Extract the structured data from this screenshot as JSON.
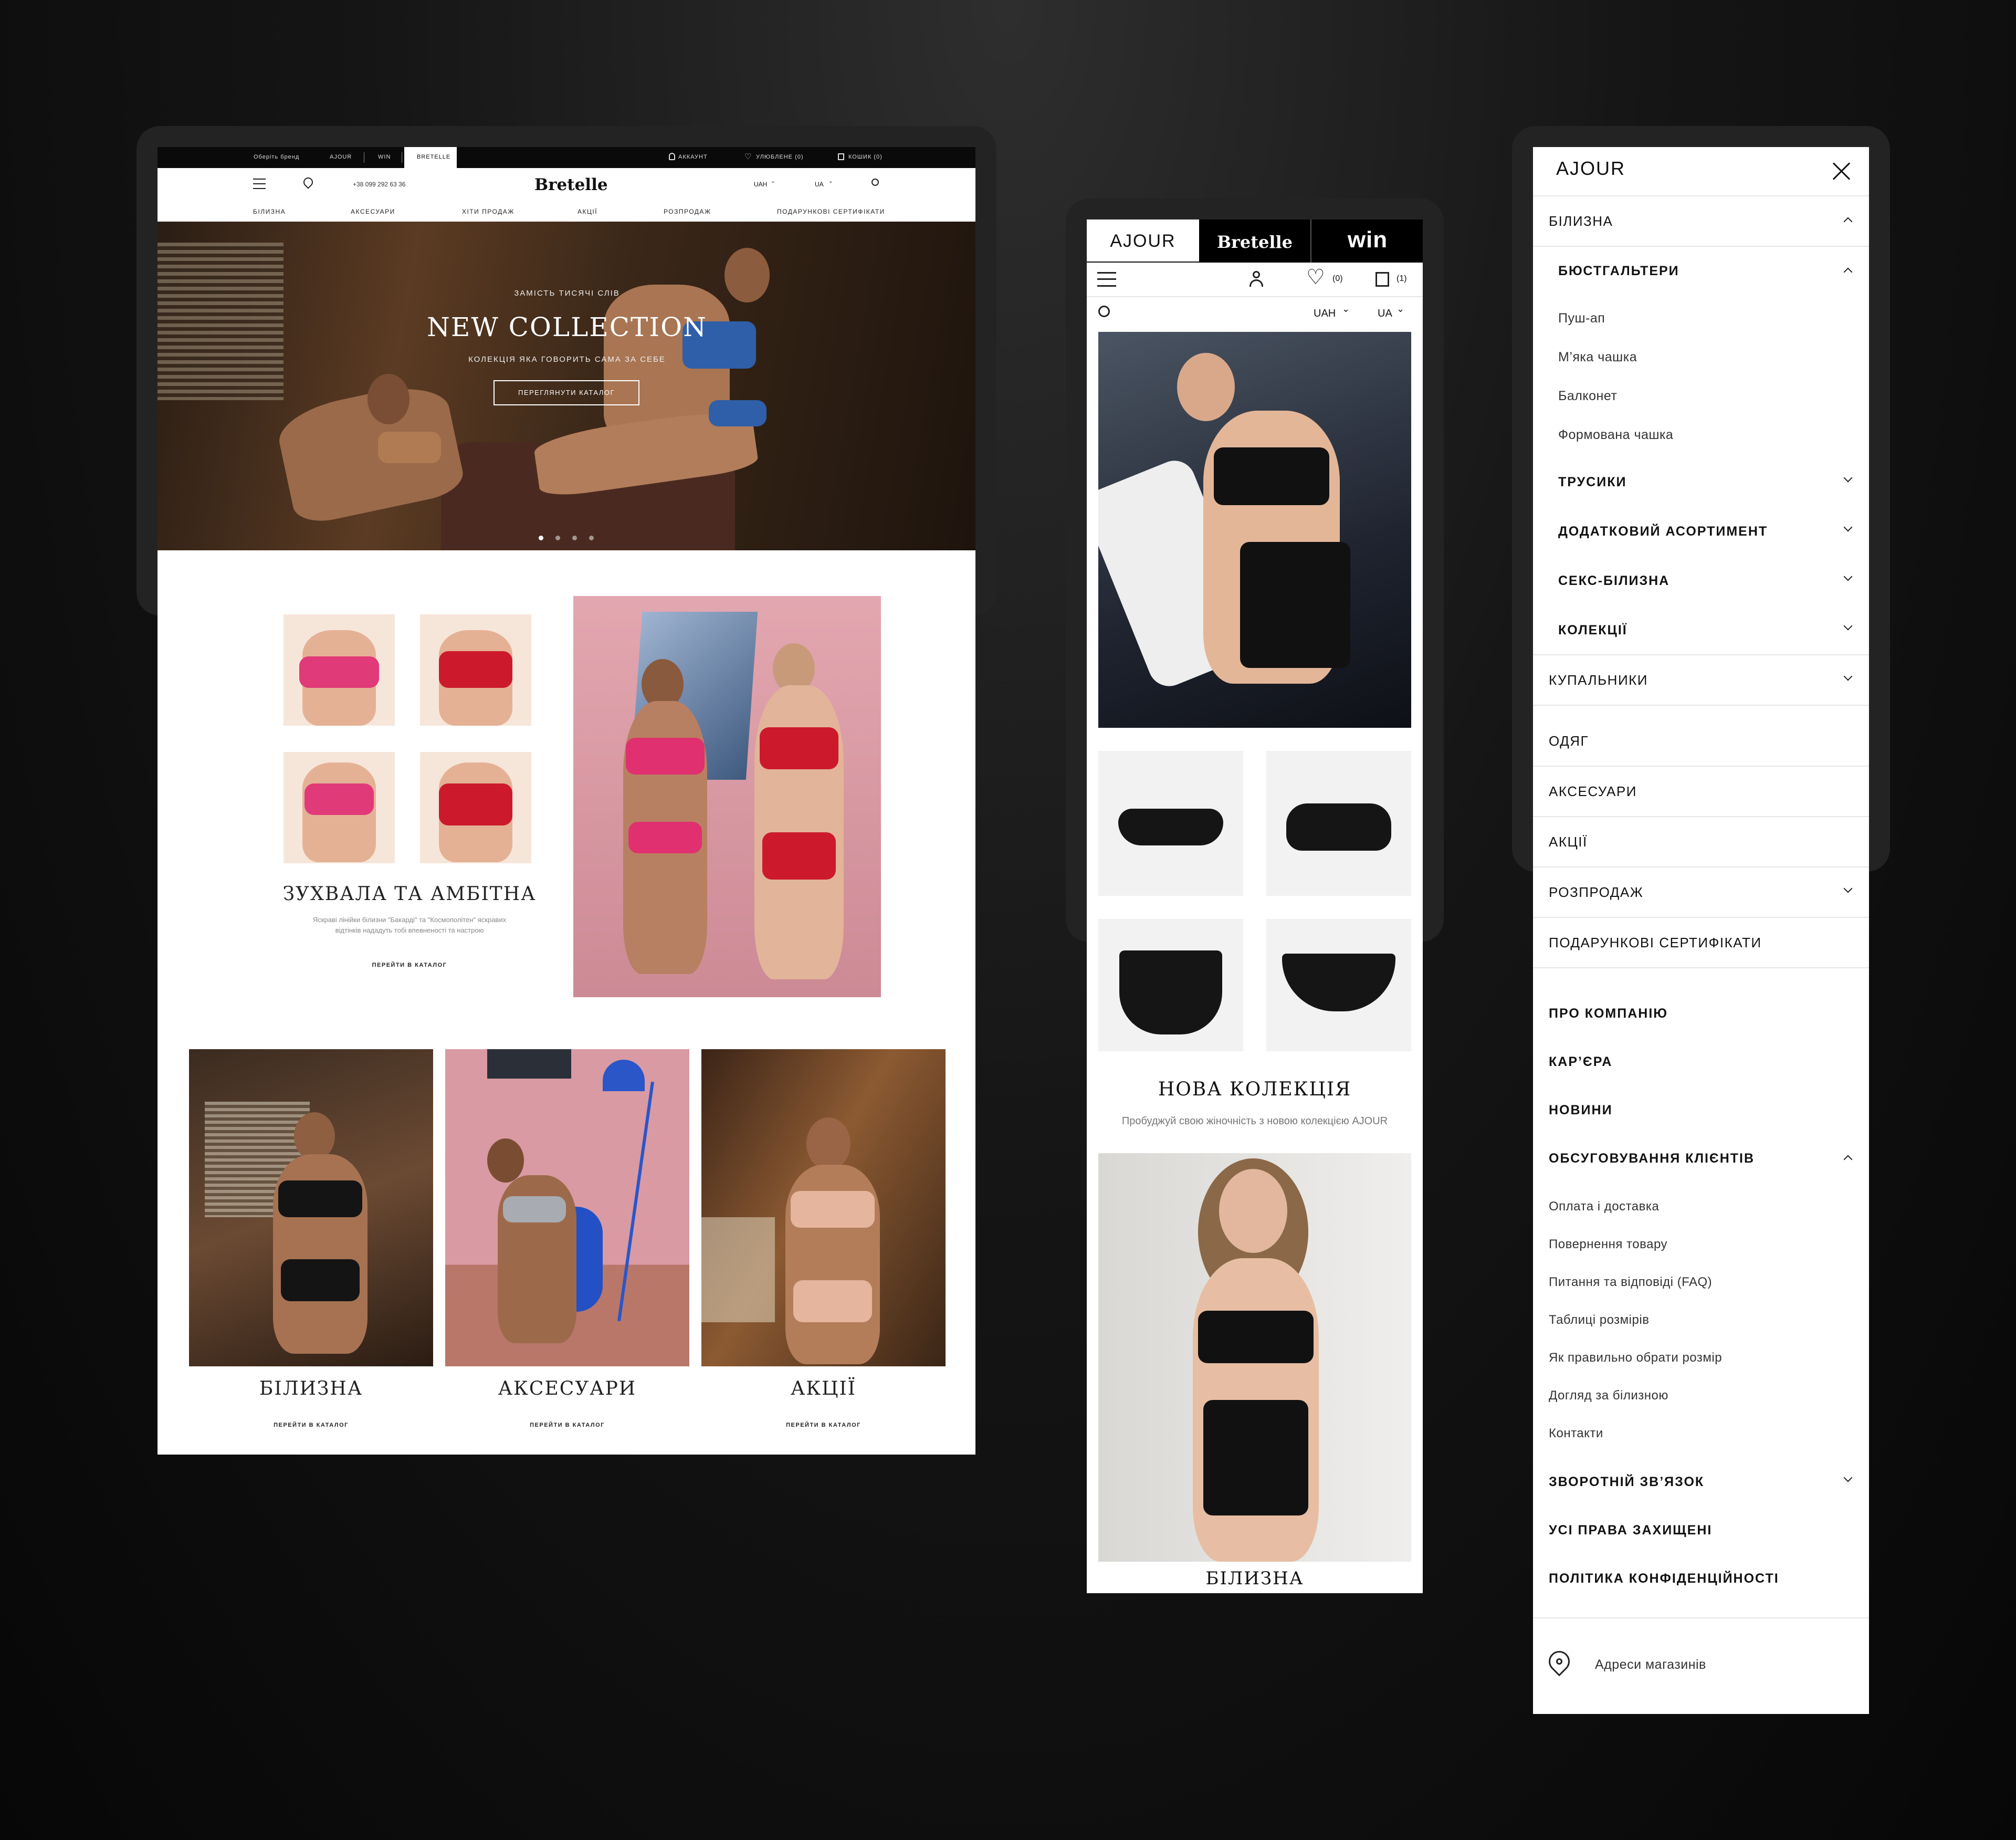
{
  "desktop": {
    "topbar": {
      "choose_brand": "Оберіть бренд",
      "brands": [
        "AJOUR",
        "WIN",
        "BRETELLE"
      ],
      "account": "АККАУНТ",
      "favorites": "УЛЮБЛЕНЕ (0)",
      "cart": "КОШИК (0)"
    },
    "header": {
      "logo": "Bretelle",
      "phone": "+38 099 292 63 36",
      "currency": "UAH",
      "language": "UA"
    },
    "nav": [
      "БІЛИЗНА",
      "АКСЕСУАРИ",
      "ХІТИ ПРОДАЖ",
      "АКЦІЇ",
      "РОЗПРОДАЖ",
      "ПОДАРУНКОВІ СЕРТИФІКАТИ"
    ],
    "hero": {
      "kicker": "ЗАМІСТЬ ТИСЯЧІ СЛІВ",
      "title": "NEW COLLECTION",
      "subtitle": "КОЛЕКЦІЯ ЯКА ГОВОРИТЬ САМА ЗА СЕБЕ",
      "cta": "ПЕРЕГЛЯНУТИ КАТАЛОГ",
      "slides": 4,
      "active_slide": 1
    },
    "promo": {
      "title": "ЗУХВАЛА ТА АМБІТНА",
      "text_line1": "Яскраві лінійки білизни \"Бакарді\" та \"Космополітен\" яскравих",
      "text_line2": "відтінків нададуть тобі впевненості та настрою",
      "link": "ПЕРЕЙТИ В КАТАЛОГ"
    },
    "categories": [
      {
        "title": "БІЛИЗНА",
        "link": "ПЕРЕЙТИ В КАТАЛОГ"
      },
      {
        "title": "АКСЕСУАРИ",
        "link": "ПЕРЕЙТИ В КАТАЛОГ"
      },
      {
        "title": "АКЦІЇ",
        "link": "ПЕРЕЙТИ В КАТАЛОГ"
      }
    ]
  },
  "mobile": {
    "brand_tabs": [
      "AJOUR",
      "Bretelle",
      "win"
    ],
    "favorites_count": "(0)",
    "cart_count": "(1)",
    "currency": "UAH",
    "language": "UA",
    "collection": {
      "title": "НОВА КОЛЕКЦІЯ",
      "text": "Пробуджуй свою жіночність з новою колекцією AJOUR"
    },
    "category": "БІЛИЗНА"
  },
  "menu": {
    "brand": "AJOUR",
    "lingerie": "БІЛИЗНА",
    "bras": "БЮСТГАЛЬТЕРИ",
    "bra_types": [
      "Пуш-ап",
      "М’яка чашка",
      "Балконет",
      "Формована чашка"
    ],
    "lingerie_sub": [
      "ТРУСИКИ",
      "ДОДАТКОВИЙ АСОРТИМЕНТ",
      "СЕКС-БІЛИЗНА",
      "КОЛЕКЦІЇ"
    ],
    "sections": [
      "КУПАЛЬНИКИ",
      "ОДЯГ",
      "АКСЕСУАРИ",
      "АКЦІЇ",
      "РОЗПРОДАЖ",
      "ПОДАРУНКОВІ СЕРТИФІКАТИ"
    ],
    "about": "ПРО КОМПАНІЮ",
    "career": "КАР’ЄРА",
    "news": "НОВИНИ",
    "service": "ОБСУГОВУВАННЯ КЛІЄНТІВ",
    "service_links": [
      "Оплата і доставка",
      "Повернення товару",
      "Питання та відповіді (FAQ)",
      "Таблиці розмірів",
      "Як правильно обрати розмір",
      "Догляд за білизною",
      "Контакти"
    ],
    "feedback": "ЗВОРОТНІЙ ЗВ’ЯЗОК",
    "rights": "УСІ ПРАВА ЗАХИЩЕНІ",
    "privacy": "ПОЛІТИКА КОНФІДЕНЦІЙНОСТІ",
    "stores": "Адреси магазинів"
  },
  "colors": {
    "background": "#0b0b0b",
    "frame": "#232323",
    "hero_accent": "#2f5fa8",
    "promo_pink": "#e0a3ad",
    "promo_red": "#cc1a2c"
  }
}
